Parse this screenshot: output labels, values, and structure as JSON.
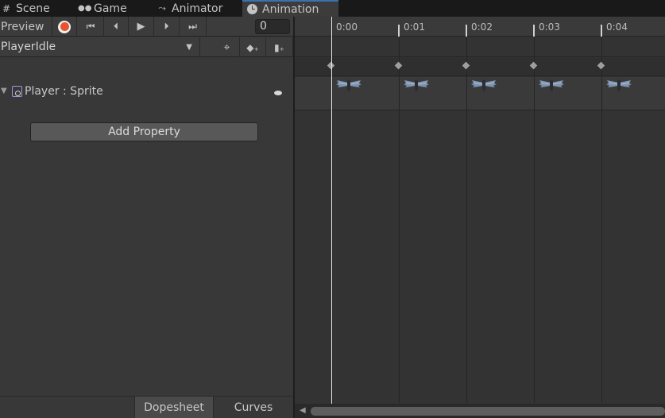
{
  "tabs": [
    {
      "label": "Scene",
      "icon": "grid-icon"
    },
    {
      "label": "Game",
      "icon": "gamepad-icon"
    },
    {
      "label": "Animator",
      "icon": "animator-icon"
    },
    {
      "label": "Animation",
      "icon": "clock-icon",
      "active": true
    }
  ],
  "toolbar": {
    "preview_label": "Preview",
    "frame_value": "0",
    "record_color": "#e8552c"
  },
  "clip": {
    "selected": "PlayerIdle"
  },
  "property": {
    "label": "Player : Sprite"
  },
  "add_property_label": "Add Property",
  "bottom_tabs": {
    "dopesheet": "Dopesheet",
    "curves": "Curves"
  },
  "timeline": {
    "ticks": [
      "0:00",
      "0:01",
      "0:02",
      "0:03",
      "0:04"
    ],
    "keyframe_count": 5,
    "playhead_time": "0:00"
  },
  "colors": {
    "accent": "#3a72b0",
    "record": "#e8552c"
  }
}
